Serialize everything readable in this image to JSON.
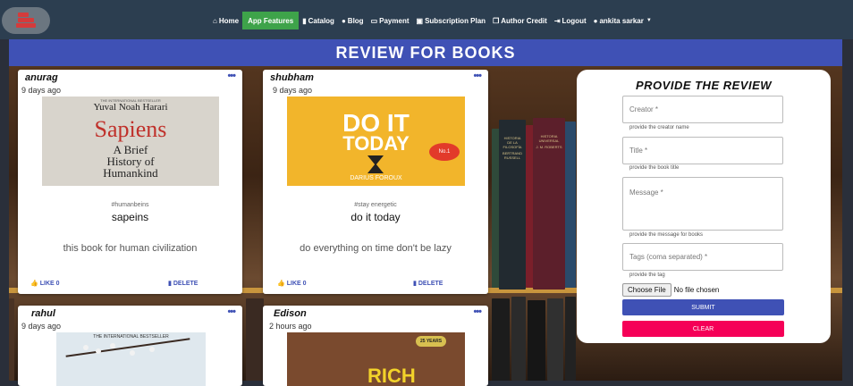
{
  "nav": {
    "home": "Home",
    "features": "App Features",
    "catalog": "Catalog",
    "blog": "Blog",
    "payment": "Payment",
    "subscription": "Subscription Plan",
    "author_credit": "Author Credit",
    "logout": "Logout",
    "user": "ankita sarkar"
  },
  "page_title": "REVIEW FOR BOOKS",
  "cards": [
    {
      "name": "anurag",
      "time": "9 days ago",
      "tag": "#humanbeins",
      "title": "sapeins",
      "message": "this book for human civilization",
      "like": "LIKE 0",
      "delete": "DELETE",
      "cover": {
        "top": "THE INTERNATIONAL BESTSELLER",
        "author": "Yuval Noah Harari",
        "t1": "Sapiens",
        "t2": "A Brief",
        "t3": "History of",
        "t4": "Humankind"
      }
    },
    {
      "name": "shubham",
      "time": "9 days ago",
      "tag": "#stay energetic",
      "title": "do it today",
      "message": "do everything on time don't be lazy",
      "like": "LIKE 0",
      "delete": "DELETE",
      "cover": {
        "t1": "DO IT",
        "t2": "TODAY",
        "author": "DARIUS FOROUX",
        "badge": "No.1"
      }
    },
    {
      "name": "rahul",
      "time": "9 days ago",
      "cover": {
        "top": "THE INTERNATIONAL BESTSELLER"
      }
    },
    {
      "name": "Edison",
      "time": "2 hours ago",
      "cover": {
        "badge": "25 YEARS",
        "t1": "RICH"
      }
    }
  ],
  "form": {
    "title": "PROVIDE THE REVIEW",
    "creator_placeholder": "Creator *",
    "creator_help": "provide the creator name",
    "title_placeholder": "Title *",
    "title_help": "provide the book title",
    "message_placeholder": "Message *",
    "message_help": "provide the message for books",
    "tags_placeholder": "Tags (coma separated) *",
    "tags_help": "provide the tag",
    "file_button": "Choose File",
    "file_status": "No file chosen",
    "submit": "SUBMIT",
    "clear": "CLEAR"
  },
  "colors": {
    "navbar": "#2c3e50",
    "accent": "#3f51b5",
    "active_nav": "#3ea34a",
    "clear": "#f50057"
  },
  "background_books": [
    {
      "t1": "HISTORIA",
      "t2": "DE LA",
      "t3": "FILOSOFÍA",
      "t4": "BERTRAND RUSSELL"
    },
    {
      "t1": "HISTORIA",
      "t2": "UNIVERSAL",
      "t3": "J. M. ROBERTS"
    }
  ]
}
